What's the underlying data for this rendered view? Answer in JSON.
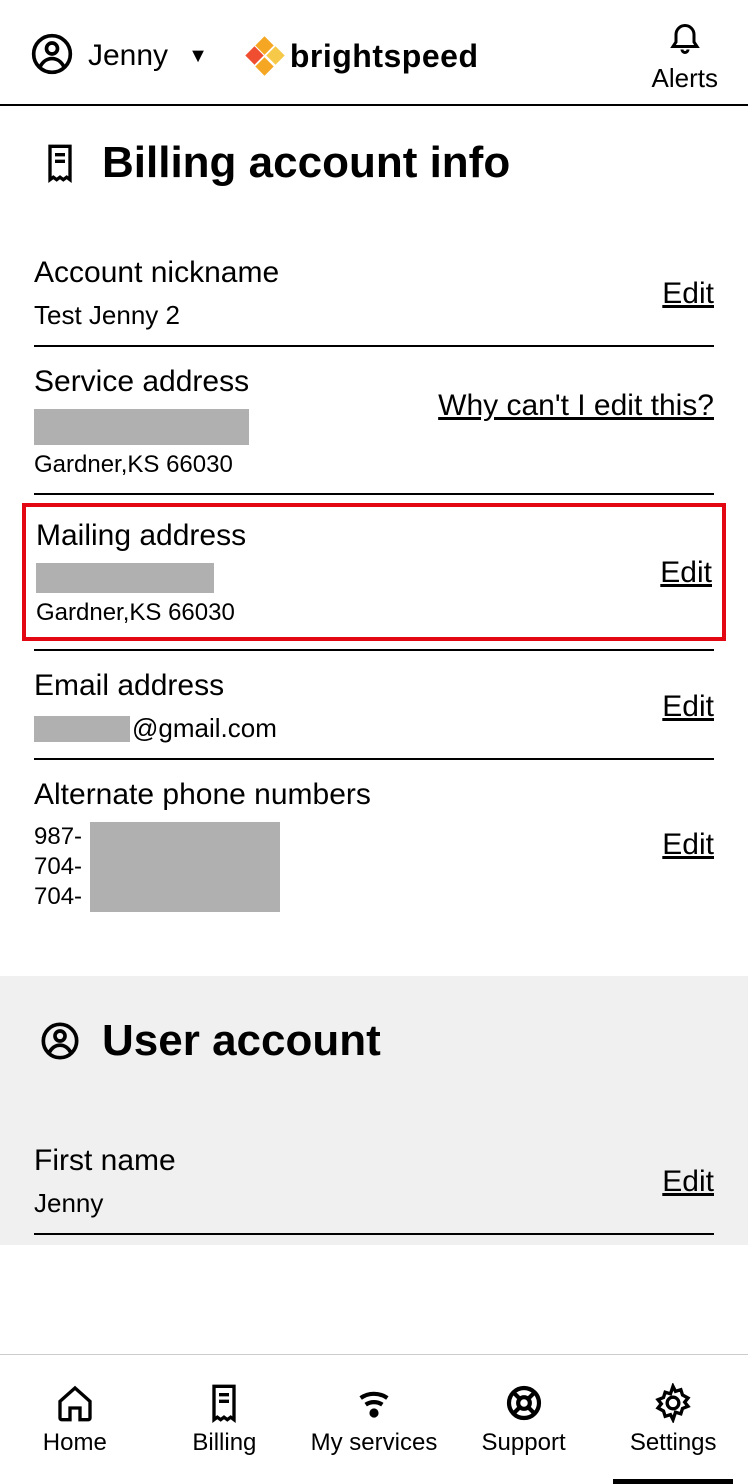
{
  "header": {
    "user_name": "Jenny",
    "brand": "brightspeed",
    "alerts_label": "Alerts"
  },
  "billing": {
    "title": "Billing account info",
    "nickname": {
      "label": "Account nickname",
      "value": "Test Jenny 2",
      "action": "Edit"
    },
    "service": {
      "label": "Service address",
      "city": "Gardner,KS 66030",
      "action": "Why can't I edit this?"
    },
    "mailing": {
      "label": "Mailing address",
      "city": "Gardner,KS 66030",
      "action": "Edit"
    },
    "email": {
      "label": "Email address",
      "suffix": "@gmail.com",
      "action": "Edit"
    },
    "phones": {
      "label": "Alternate phone numbers",
      "prefixes": [
        "987-",
        "704-",
        "704-"
      ],
      "action": "Edit"
    }
  },
  "user_account": {
    "title": "User account",
    "first_name": {
      "label": "First name",
      "value": "Jenny",
      "action": "Edit"
    }
  },
  "nav": {
    "home": "Home",
    "billing": "Billing",
    "services": "My services",
    "support": "Support",
    "settings": "Settings"
  }
}
